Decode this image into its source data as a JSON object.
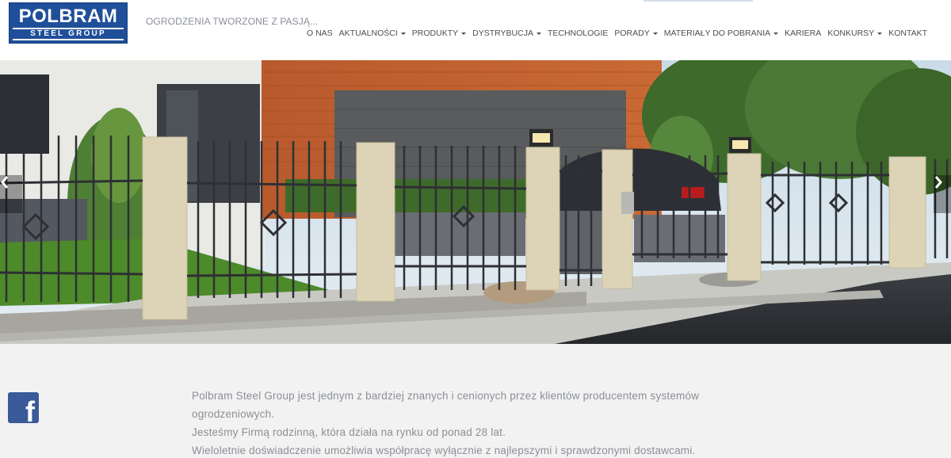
{
  "brand": {
    "name": "POLBRAM",
    "subname": "STEEL GROUP",
    "tagline": "OGRODZENIA TWORZONE Z PASJĄ...",
    "color": "#1f4f99"
  },
  "nav": [
    {
      "label": "O NAS",
      "dropdown": false
    },
    {
      "label": "AKTUALNOŚCI",
      "dropdown": true
    },
    {
      "label": "PRODUKTY",
      "dropdown": true
    },
    {
      "label": "DYSTRYBUCJA",
      "dropdown": true
    },
    {
      "label": "TECHNOLOGIE",
      "dropdown": false
    },
    {
      "label": "PORADY",
      "dropdown": true
    },
    {
      "label": "MATERIAŁY DO POBRANIA",
      "dropdown": true
    },
    {
      "label": "KARIERA",
      "dropdown": false
    },
    {
      "label": "KONKURSY",
      "dropdown": true
    },
    {
      "label": "KONTAKT",
      "dropdown": false
    }
  ],
  "slider": {
    "prev_icon": "chevron-left-icon",
    "next_icon": "chevron-right-icon"
  },
  "social": {
    "facebook_icon": "facebook-icon",
    "facebook_letter": "f",
    "facebook_color": "#3a5a99"
  },
  "about": {
    "lines": [
      "Polbram Steel Group jest jednym z bardziej znanych i cenionych przez klientów producentem systemów ogrodzeniowych.",
      "Jesteśmy Firmą rodzinną, która działa na rynku od ponad 28 lat.",
      "Wieloletnie doświadczenie umożliwia współpracę wyłącznie z najlepszymi i sprawdzonymi dostawcami."
    ]
  }
}
